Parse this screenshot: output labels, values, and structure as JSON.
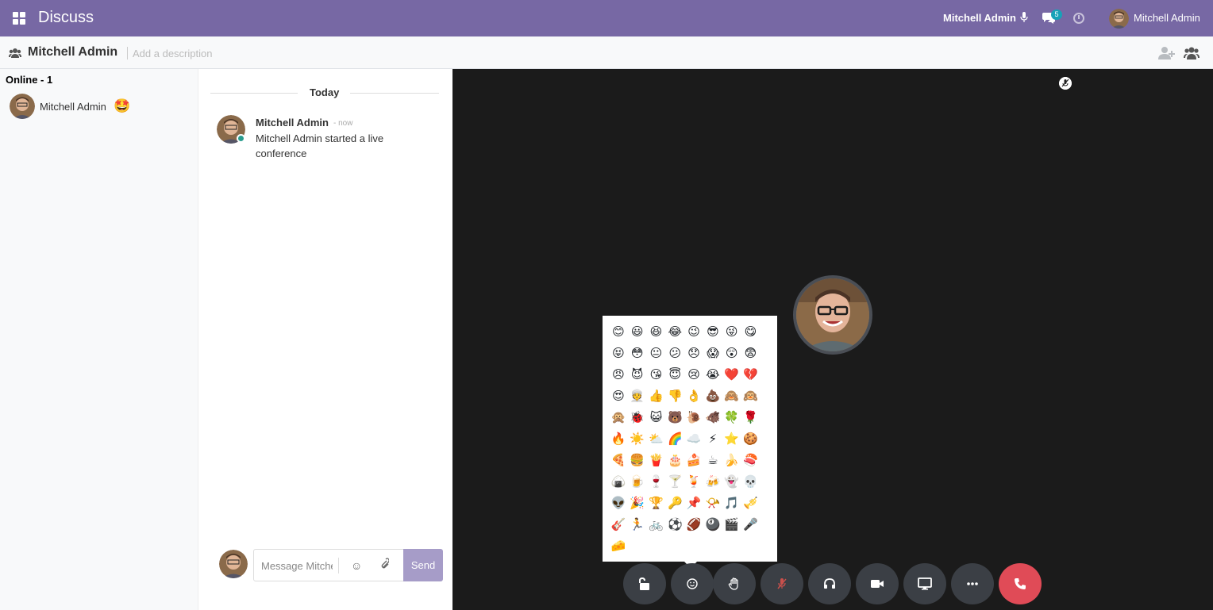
{
  "navbar": {
    "app_title": "Discuss",
    "user_status": "Mitchell Admin",
    "chat_badge": "5",
    "user_name": "Mitchell Admin",
    "icons": [
      "apps-icon",
      "microphone-icon",
      "chat-icon",
      "clock-icon",
      "avatar"
    ],
    "color": "#7768a4"
  },
  "control_panel": {
    "channel_name": "Mitchell Admin",
    "description_placeholder": "Add a description",
    "icons": [
      "users-icon",
      "add-user-icon",
      "members-icon"
    ]
  },
  "member_list": {
    "header": "Online - 1",
    "members": [
      {
        "name": "Mitchell Admin",
        "emoji": "🤩"
      }
    ]
  },
  "thread": {
    "date_separator": "Today",
    "messages": [
      {
        "author": "Mitchell Admin",
        "date": "- now",
        "body": "Mitchell Admin started a live conference"
      }
    ],
    "composer": {
      "placeholder": "Message Mitchell Admin...",
      "send_label": "Send"
    }
  },
  "emoji_picker": {
    "emojis": [
      "😊",
      "😃",
      "😆",
      "😂",
      "😉",
      "😎",
      "😜",
      "😋",
      "😝",
      "😳",
      "😐",
      "😕",
      "😞",
      "😱",
      "😲",
      "😨",
      "😠",
      "😈",
      "😘",
      "😇",
      "😢",
      "😭",
      "❤️",
      "💔",
      "😍",
      "👳",
      "👍",
      "👎",
      "👌",
      "💩",
      "🙈",
      "🙉",
      "🙊",
      "🐞",
      "😺",
      "🐻",
      "🐌",
      "🐗",
      "🍀",
      "🌹",
      "🔥",
      "☀️",
      "⛅",
      "🌈",
      "☁️",
      "⚡",
      "⭐",
      "🍪",
      "🍕",
      "🍔",
      "🍟",
      "🎂",
      "🍰",
      "☕",
      "🍌",
      "🍣",
      "🍙",
      "🍺",
      "🍷",
      "🍸",
      "🍹",
      "🍻",
      "👻",
      "💀",
      "👽",
      "🎉",
      "🏆",
      "🔑",
      "📌",
      "📯",
      "🎵",
      "🎺",
      "🎸",
      "🏃",
      "🚲",
      "⚽",
      "🏈",
      "🎱",
      "🎬",
      "🎤",
      "🧀"
    ]
  },
  "call_actions": [
    {
      "name": "unlock-button",
      "icon": "unlock-icon"
    },
    {
      "name": "emoji-reaction-button",
      "icon": "smile-icon"
    },
    {
      "name": "raise-hand-button",
      "icon": "hand-icon"
    },
    {
      "name": "mute-button",
      "icon": "microphone-slash-icon"
    },
    {
      "name": "deafen-button",
      "icon": "headphones-icon"
    },
    {
      "name": "camera-button",
      "icon": "video-icon"
    },
    {
      "name": "share-screen-button",
      "icon": "desktop-icon"
    },
    {
      "name": "more-button",
      "icon": "ellipsis-icon"
    },
    {
      "name": "hang-up-button",
      "icon": "phone-icon"
    }
  ],
  "colors": {
    "call_background": "#1b1b1b",
    "send_button": "#a69cc8",
    "hang_up": "#e04b57",
    "online_dot": "#2a9d8f"
  }
}
